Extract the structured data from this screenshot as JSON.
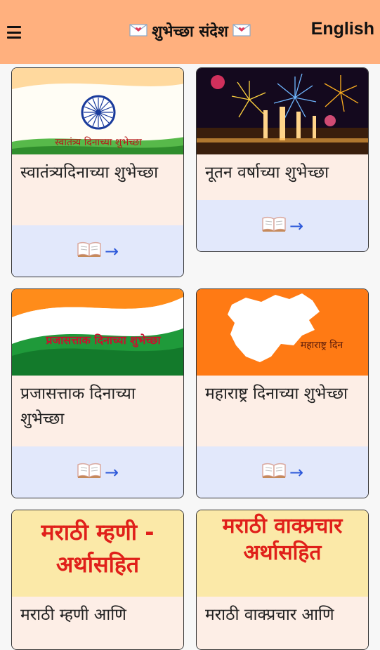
{
  "header": {
    "title": "शुभेच्छा संदेश",
    "language_toggle": "English",
    "menu_icon": "hamburger-menu-icon",
    "title_icon": "love-letter-envelope-icon"
  },
  "colors": {
    "header_bg": "#ffb07e",
    "caption_bg": "#fdeee6",
    "action_bg": "#e2e8fb",
    "arrow": "#2b57d9"
  },
  "cards": [
    {
      "image_text": "स्वातंत्र्य दिनाच्या शुभेच्छा",
      "caption": "स्वातंत्र्यदिनाच्या शुभेच्छा",
      "action_arrow": "→"
    },
    {
      "image_text": "",
      "caption": "नूतन वर्षाच्या शुभेच्छा",
      "action_arrow": "→"
    },
    {
      "image_text": "प्रजासत्ताक दिनाच्या शुभेच्छा",
      "caption": "प्रजासत्ताक दिनाच्या शुभेच्छा",
      "action_arrow": "→"
    },
    {
      "image_text": "महाराष्ट्र दिन",
      "caption": "महाराष्ट्र दिनाच्या शुभेच्छा",
      "action_arrow": "→"
    },
    {
      "image_text": "मराठी म्हणी - अर्थासहित",
      "caption": "मराठी म्हणी आणि",
      "action_arrow": "→"
    },
    {
      "image_text": "मराठी वाक्प्रचार अर्थासहित",
      "caption": "मराठी वाक्प्रचार आणि",
      "action_arrow": "→"
    }
  ]
}
